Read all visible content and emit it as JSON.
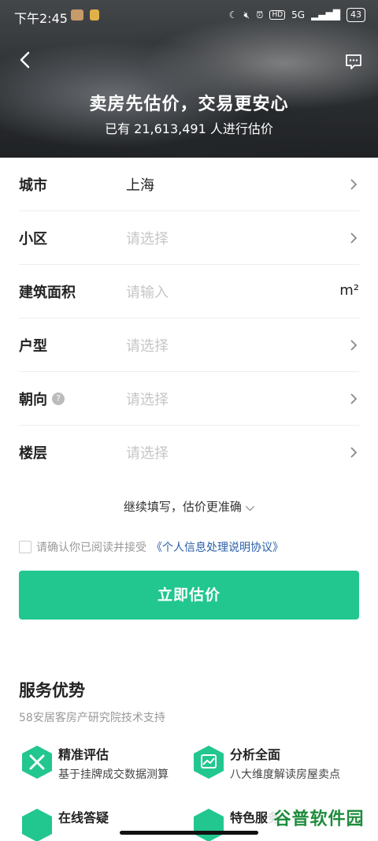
{
  "status_bar": {
    "time": "下午2:45",
    "network": "5G",
    "battery": "43"
  },
  "header": {
    "title": "卖房先估价，交易更安心",
    "subtitle": "已有 21,613,491 人进行估价"
  },
  "form": {
    "city": {
      "label": "城市",
      "value": "上海"
    },
    "community": {
      "label": "小区",
      "placeholder": "请选择"
    },
    "area": {
      "label": "建筑面积",
      "placeholder": "请输入",
      "unit": "m²"
    },
    "layout": {
      "label": "户型",
      "placeholder": "请选择"
    },
    "orientation": {
      "label": "朝向",
      "placeholder": "请选择"
    },
    "floor": {
      "label": "楼层",
      "placeholder": "请选择"
    },
    "more_toggle": "继续填写，估价更准确 ⌵",
    "agreement_text": "请确认你已阅读并接受",
    "agreement_link": "《个人信息处理说明协议》",
    "submit_label": "立即估价"
  },
  "service": {
    "title": "服务优势",
    "subtitle": "58安居客房产研究院技术支持",
    "features": [
      {
        "name": "精准评估",
        "desc": "基于挂牌成交数据测算",
        "icon": "tools-icon"
      },
      {
        "name": "分析全面",
        "desc": "八大维度解读房屋卖点",
        "icon": "chart-icon"
      },
      {
        "name": "在线答疑",
        "desc": "",
        "icon": "chat-icon"
      },
      {
        "name": "特色服务",
        "desc": "",
        "icon": "document-icon"
      }
    ]
  },
  "watermark": "谷普软件园",
  "colors": {
    "accent": "#21c78e",
    "link": "#2a5ea8",
    "placeholder": "#c6c6c6"
  }
}
